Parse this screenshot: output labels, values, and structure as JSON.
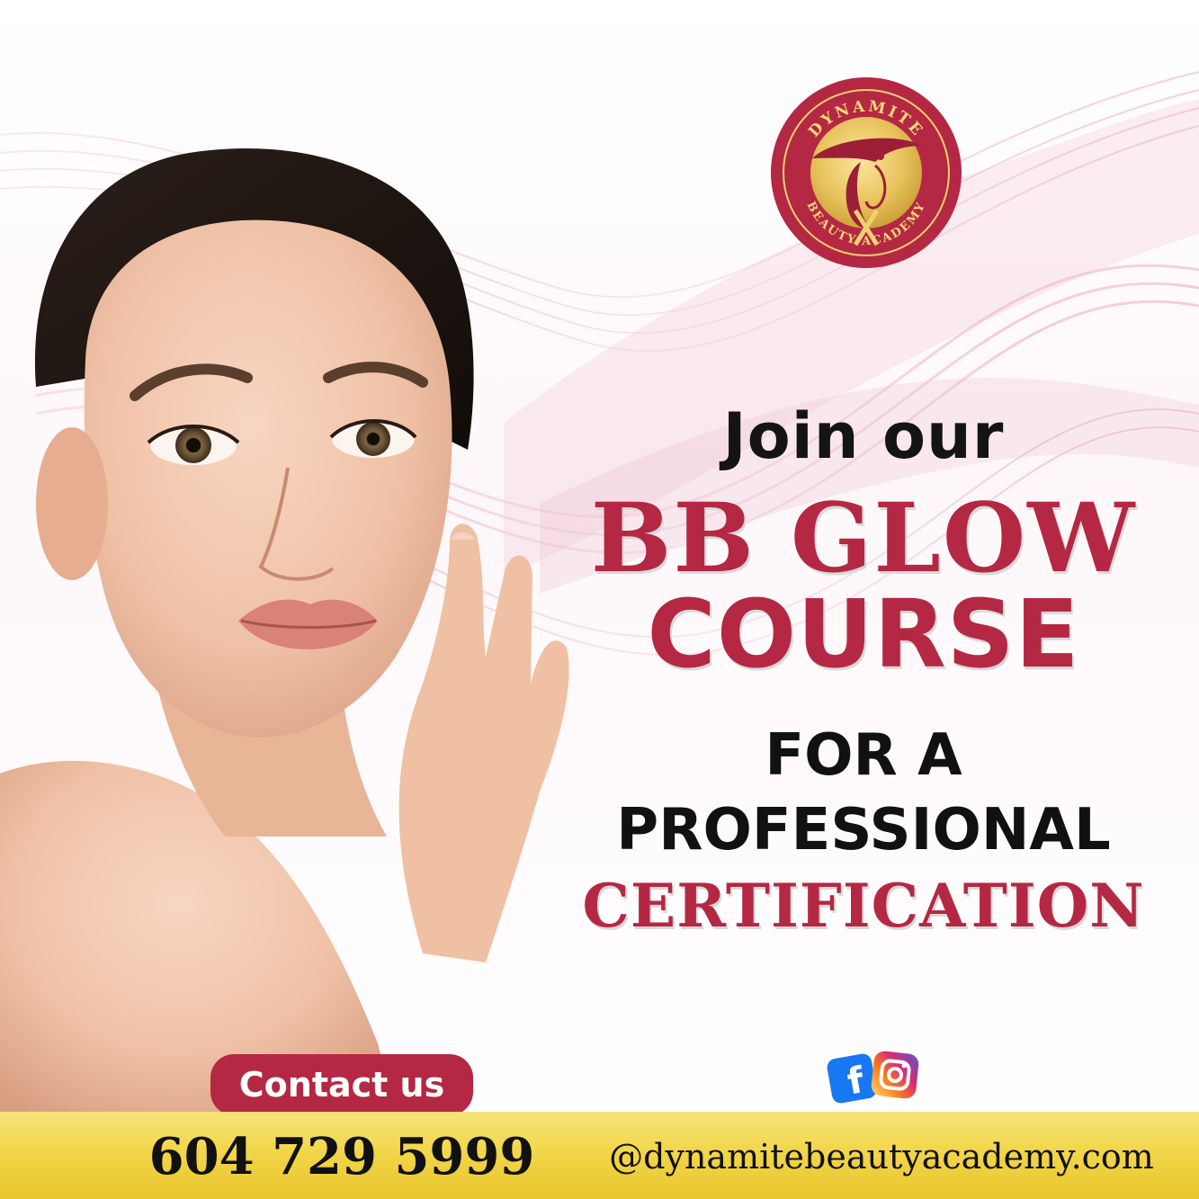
{
  "brand": {
    "logo_text_top": "DYNAMITE",
    "logo_text_bottom": "BEAUTY ACADEMY",
    "colors": {
      "primary": "#b42843",
      "gold": "#f2d64a",
      "dark_text": "#111111",
      "ribbon": "#e9b9c9"
    }
  },
  "headline": {
    "line1": "Join our",
    "line2": "BB GLOW",
    "line3": "COURSE",
    "line4": "FOR A",
    "line5": "PROFESSIONAL",
    "line6": "CERTIFICATION"
  },
  "cta": {
    "contact_label": "Contact us"
  },
  "social": {
    "icons": [
      "facebook-icon",
      "instagram-icon"
    ]
  },
  "footer": {
    "phone": "604 729 5999",
    "website": "@dynamitebeautyacademy.com"
  }
}
